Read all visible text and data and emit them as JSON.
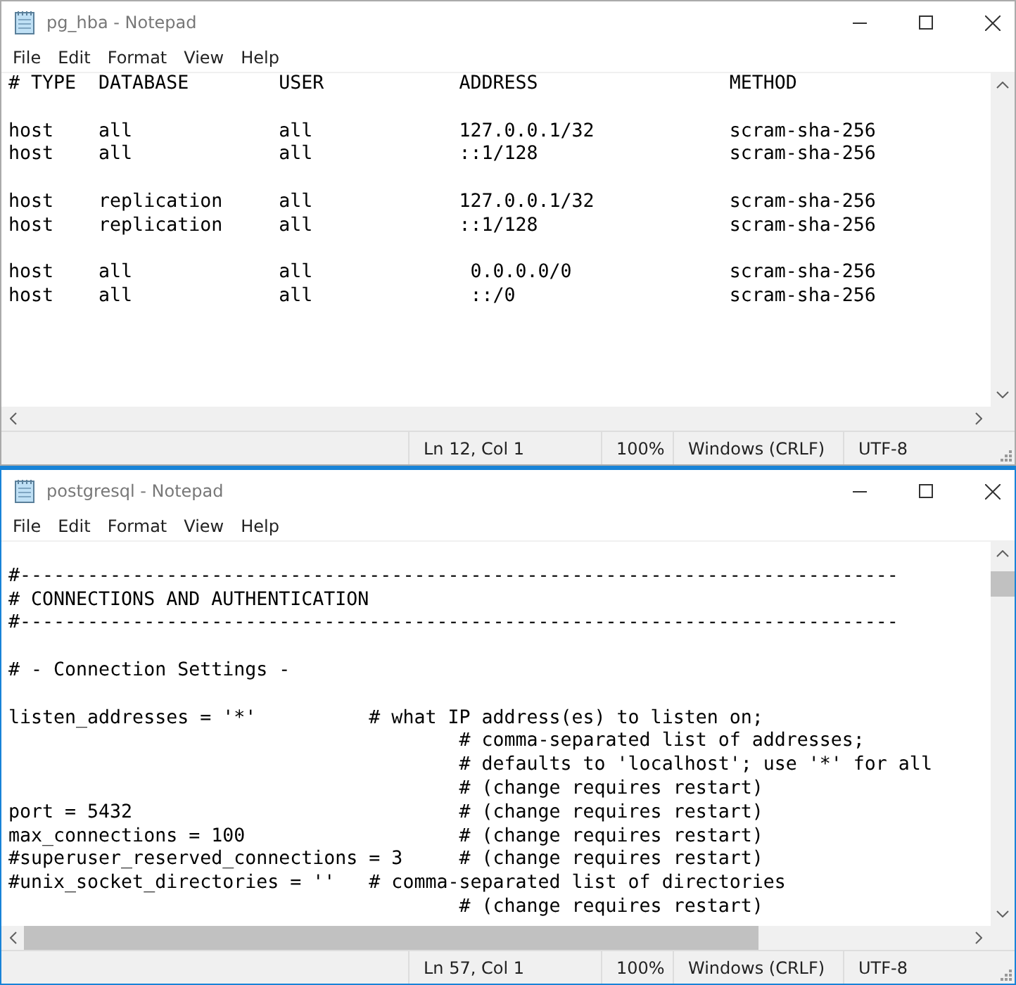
{
  "windows": [
    {
      "title": "pg_hba - Notepad",
      "active": false,
      "scrolled": false,
      "menu": [
        "File",
        "Edit",
        "Format",
        "View",
        "Help"
      ],
      "editor": {
        "leading_blank": false,
        "blocks": [
          [
            "# TYPE  DATABASE        USER            ADDRESS                 METHOD"
          ],
          [
            "host    all             all             127.0.0.1/32            scram-sha-256",
            "host    all             all             ::1/128                 scram-sha-256"
          ],
          [
            "host    replication     all             127.0.0.1/32            scram-sha-256",
            "host    replication     all             ::1/128                 scram-sha-256"
          ],
          [
            "host    all             all              0.0.0.0/0              scram-sha-256",
            "host    all             all              ::/0                   scram-sha-256"
          ]
        ]
      },
      "status": [
        "Ln 12, Col 1",
        "100%",
        "Windows (CRLF)",
        "UTF-8"
      ]
    },
    {
      "title": "postgresql - Notepad",
      "active": true,
      "scrolled": true,
      "menu": [
        "File",
        "Edit",
        "Format",
        "View",
        "Help"
      ],
      "editor": {
        "leading_blank": true,
        "blocks": [
          [
            "#------------------------------------------------------------------------------",
            "# CONNECTIONS AND AUTHENTICATION",
            "#------------------------------------------------------------------------------"
          ],
          [
            "# - Connection Settings -"
          ],
          [
            "listen_addresses = '*'          # what IP address(es) to listen on;",
            "                                        # comma-separated list of addresses;",
            "                                        # defaults to 'localhost'; use '*' for all",
            "                                        # (change requires restart)",
            "port = 5432                             # (change requires restart)",
            "max_connections = 100                   # (change requires restart)",
            "#superuser_reserved_connections = 3     # (change requires restart)",
            "#unix_socket_directories = ''   # comma-separated list of directories",
            "                                        # (change requires restart)"
          ]
        ]
      },
      "status": [
        "Ln 57, Col 1",
        "100%",
        "Windows (CRLF)",
        "UTF-8"
      ]
    }
  ]
}
